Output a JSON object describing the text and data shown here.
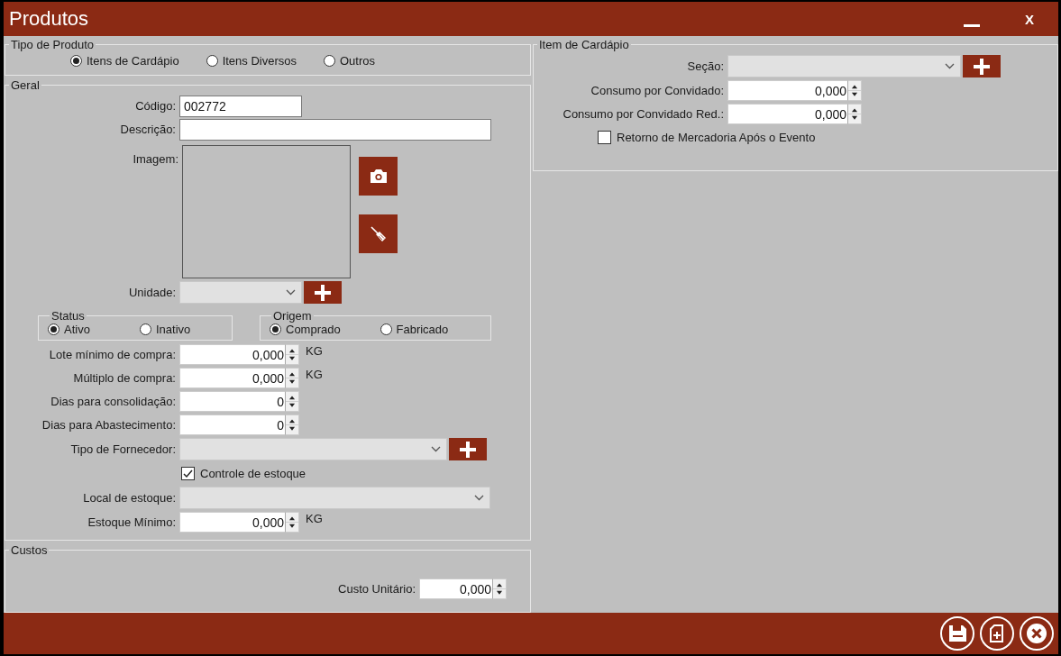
{
  "window": {
    "title": "Produtos",
    "close_label": "X"
  },
  "tipo_de_produto": {
    "legend": "Tipo de Produto",
    "options": [
      {
        "label": "Itens de Cardápio",
        "selected": true
      },
      {
        "label": "Itens Diversos",
        "selected": false
      },
      {
        "label": "Outros",
        "selected": false
      }
    ]
  },
  "geral": {
    "legend": "Geral",
    "codigo": {
      "label": "Código:",
      "value": "002772"
    },
    "descricao": {
      "label": "Descrição:"
    },
    "imagem": {
      "label": "Imagem:"
    },
    "unidade": {
      "label": "Unidade:"
    },
    "status": {
      "legend": "Status",
      "options": [
        {
          "label": "Ativo",
          "selected": true
        },
        {
          "label": "Inativo",
          "selected": false
        }
      ]
    },
    "origem": {
      "legend": "Origem",
      "options": [
        {
          "label": "Comprado",
          "selected": true
        },
        {
          "label": "Fabricado",
          "selected": false
        }
      ]
    },
    "fields": [
      {
        "kind": "spin",
        "label": "Lote mínimo de compra:",
        "value": "0,000",
        "unit": "KG"
      },
      {
        "kind": "spin",
        "label": "Múltiplo de compra:",
        "value": "0,000",
        "unit": "KG"
      },
      {
        "kind": "spin",
        "label": "Dias para consolidação:",
        "value": "0"
      },
      {
        "kind": "spin",
        "label": "Dias para Abastecimento:",
        "value": "0"
      },
      {
        "kind": "combo",
        "label": "Tipo de Fornecedor:",
        "add": true
      },
      {
        "kind": "checkbox",
        "label": "Controle de estoque",
        "checked": true
      },
      {
        "kind": "combo",
        "label": "Local de estoque:",
        "add": false
      },
      {
        "kind": "spin",
        "label": "Estoque Mínimo:",
        "value": "0,000",
        "unit": "KG"
      }
    ]
  },
  "custos": {
    "legend": "Custos",
    "fields": [
      {
        "kind": "spin",
        "label": "Custo Unitário:",
        "value": "0,000"
      }
    ]
  },
  "item_de_cardapio": {
    "legend": "Item de Cardápio",
    "fields": [
      {
        "kind": "combo",
        "label": "Seção:",
        "add": true
      },
      {
        "kind": "spin",
        "label": "Consumo por Convidado:",
        "value": "0,000"
      },
      {
        "kind": "spin",
        "label": "Consumo por Convidado Red.:",
        "value": "0,000"
      },
      {
        "kind": "checkbox",
        "label": "Retorno de Mercadoria Após o Evento",
        "checked": false
      }
    ]
  }
}
